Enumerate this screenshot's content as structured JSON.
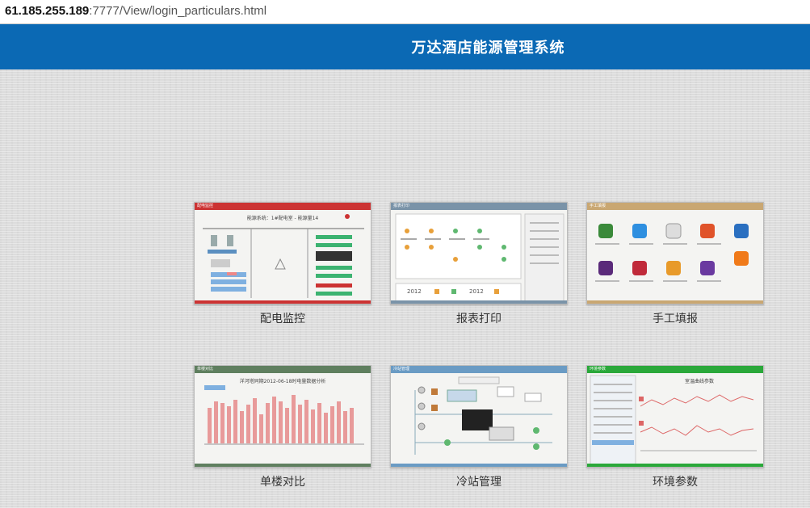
{
  "address": {
    "host": "61.185.255.189",
    "rest": ":7777/View/login_particulars.html"
  },
  "header": {
    "title": "万达酒店能源管理系统"
  },
  "tiles": [
    {
      "label": "配电监控",
      "accent": "#cc3333",
      "thumb_name": "配电监控",
      "thumb_caption": "能源系统：1#配电室 - 能源量14"
    },
    {
      "label": "报表打印",
      "accent": "#7a93a8",
      "thumb_name": "报表打印",
      "year_left": "2012",
      "year_right": "2012"
    },
    {
      "label": "手工填报",
      "accent": "#c9a772",
      "thumb_name": "手工填报"
    },
    {
      "label": "单楼对比",
      "accent": "#5f7f5f",
      "thumb_name": "单楼对比",
      "thumb_caption": "洋河塔同期2012-06-18时电量数据分析"
    },
    {
      "label": "冷站管理",
      "accent": "#6a9bc4",
      "thumb_name": "冷站管理"
    },
    {
      "label": "环境参数",
      "accent": "#2aa83a",
      "thumb_name": "环境参数",
      "thumb_caption": "室温曲线参数"
    }
  ],
  "colors": {
    "header_bg": "#0b69b4",
    "page_bg": "#dcdcdc"
  }
}
